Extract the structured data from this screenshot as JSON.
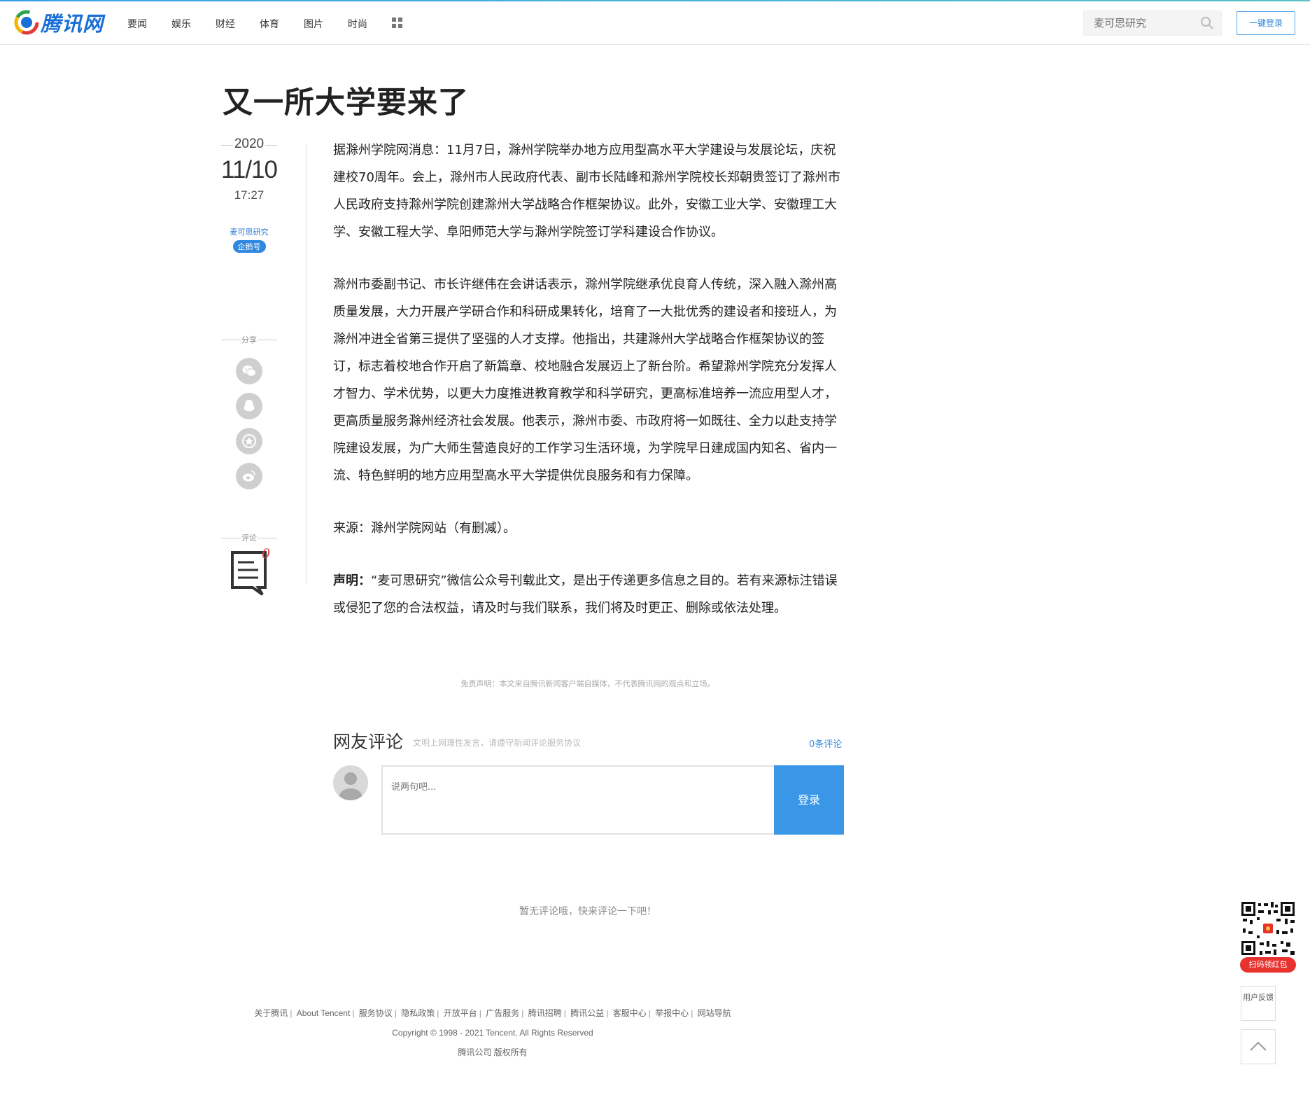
{
  "header": {
    "logo_text": "腾讯网",
    "nav": [
      "要闻",
      "娱乐",
      "财经",
      "体育",
      "图片",
      "时尚"
    ],
    "search_placeholder": "麦可思研究",
    "login_label": "一键登录"
  },
  "article": {
    "title": "又一所大学要来了",
    "date": {
      "year": "2020",
      "month_day": "11/10",
      "time": "17:27"
    },
    "author": "麦可思研究",
    "author_badge": "企鹅号",
    "share_label": "分享",
    "comment_label": "评论",
    "comment_count": "0",
    "paragraphs": [
      "据滁州学院网消息：11月7日，滁州学院举办地方应用型高水平大学建设与发展论坛，庆祝建校70周年。会上，滁州市人民政府代表、副市长陆峰和滁州学院校长郑朝贵签订了滁州市人民政府支持滁州学院创建滁州大学战略合作框架协议。此外，安徽工业大学、安徽理工大学、安徽工程大学、阜阳师范大学与滁州学院签订学科建设合作协议。",
      "滁州市委副书记、市长许继伟在会讲话表示，滁州学院继承优良育人传统，深入融入滁州高质量发展，大力开展产学研合作和科研成果转化，培育了一大批优秀的建设者和接班人，为滁州冲进全省第三提供了坚强的人才支撑。他指出，共建滁州大学战略合作框架协议的签订，标志着校地合作开启了新篇章、校地融合发展迈上了新台阶。希望滁州学院充分发挥人才智力、学术优势，以更大力度推进教育教学和科学研究，更高标准培养一流应用型人才，更高质量服务滁州经济社会发展。他表示，滁州市委、市政府将一如既往、全力以赴支持学院建设发展，为广大师生营造良好的工作学习生活环境，为学院早日建成国内知名、省内一流、特色鲜明的地方应用型高水平大学提供优良服务和有力保障。",
      "来源：滁州学院网站（有删减）。"
    ],
    "statement_label": "声明：",
    "statement_text": "“麦可思研究”微信公众号刊载此文，是出于传递更多信息之目的。若有来源标注错误或侵犯了您的合法权益，请及时与我们联系，我们将及时更正、删除或依法处理。",
    "disclaimer": "免责声明：本文来自腾讯新闻客户端自媒体，不代表腾讯网的观点和立场。"
  },
  "comments": {
    "title": "网友评论",
    "hint": "文明上网理性发言，请遵守新闻评论服务协议",
    "count_label": "0条评论",
    "input_placeholder": "说两句吧...",
    "login_label": "登录",
    "empty_text": "暂无评论哦，快来评论一下吧！"
  },
  "footer": {
    "links": [
      "关于腾讯",
      "About Tencent",
      "服务协议",
      "隐私政策",
      "开放平台",
      "广告服务",
      "腾讯招聘",
      "腾讯公益",
      "客服中心",
      "举报中心",
      "网站导航"
    ],
    "copyright": "Copyright © 1998 - 2021 Tencent. All Rights Reserved",
    "company": "腾讯公司 版权所有"
  },
  "float": {
    "qr_label": "扫码领红包",
    "feedback_label": "用户反馈"
  },
  "colors": {
    "brand_blue": "#1a6fd6",
    "accent_blue": "#3a97e8",
    "red": "#e8322e"
  }
}
